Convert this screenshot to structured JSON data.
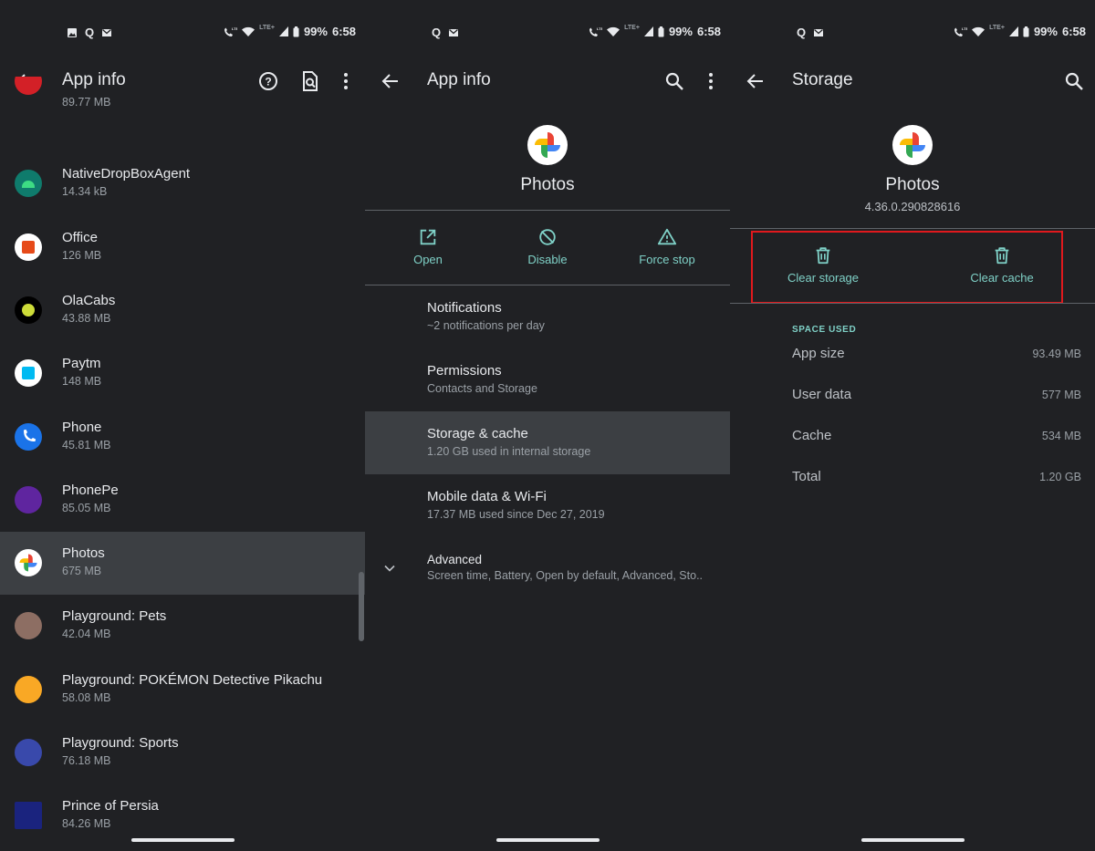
{
  "status": {
    "battery": "99%",
    "time": "6:58",
    "lte": "LTE+"
  },
  "panel1": {
    "title": "App info",
    "apps": [
      {
        "name": "",
        "size": "89.77 MB",
        "icon": "jio-icon",
        "color": "#d32027"
      },
      {
        "name": "NativeDropBoxAgent",
        "size": "14.34 kB",
        "icon": "android-icon",
        "color": "#3ddc84"
      },
      {
        "name": "Office",
        "size": "126 MB",
        "icon": "office-icon",
        "color": "#e64a19"
      },
      {
        "name": "OlaCabs",
        "size": "43.88 MB",
        "icon": "ola-icon",
        "color": "#cddc39"
      },
      {
        "name": "Paytm",
        "size": "148 MB",
        "icon": "paytm-icon",
        "color": "#00baf2"
      },
      {
        "name": "Phone",
        "size": "45.81 MB",
        "icon": "phone-icon",
        "color": "#1a73e8"
      },
      {
        "name": "PhonePe",
        "size": "85.05 MB",
        "icon": "phonepe-icon",
        "color": "#5f259f"
      },
      {
        "name": "Photos",
        "size": "675 MB",
        "icon": "photos-icon",
        "color": "#ffffff"
      },
      {
        "name": "Playground: Pets",
        "size": "42.04 MB",
        "icon": "playground-pets-icon",
        "color": "#8d6e63"
      },
      {
        "name": "Playground: POKÉMON Detective Pikachu",
        "size": "58.08 MB",
        "icon": "pikachu-icon",
        "color": "#f9a825"
      },
      {
        "name": "Playground: Sports",
        "size": "76.18 MB",
        "icon": "playground-sports-icon",
        "color": "#3949ab"
      },
      {
        "name": "Prince of Persia",
        "size": "84.26 MB",
        "icon": "prince-of-persia-icon",
        "color": "#1a237e"
      }
    ]
  },
  "panel2": {
    "title": "App info",
    "app_name": "Photos",
    "actions": [
      {
        "label": "Open",
        "icon": "open-external-icon"
      },
      {
        "label": "Disable",
        "icon": "disable-icon"
      },
      {
        "label": "Force stop",
        "icon": "warning-icon"
      }
    ],
    "menu": [
      {
        "title": "Notifications",
        "sub": "~2 notifications per day"
      },
      {
        "title": "Permissions",
        "sub": "Contacts and Storage"
      },
      {
        "title": "Storage & cache",
        "sub": "1.20 GB used in internal storage"
      },
      {
        "title": "Mobile data & Wi-Fi",
        "sub": "17.37 MB used since Dec 27, 2019"
      }
    ],
    "advanced": {
      "title": "Advanced",
      "sub": "Screen time, Battery, Open by default, Advanced, Sto.."
    }
  },
  "panel3": {
    "title": "Storage",
    "app_name": "Photos",
    "version": "4.36.0.290828616",
    "actions": [
      {
        "label": "Clear storage",
        "icon": "trash-icon"
      },
      {
        "label": "Clear cache",
        "icon": "trash-icon"
      }
    ],
    "section": "SPACE USED",
    "rows": [
      {
        "key": "App size",
        "value": "93.49 MB"
      },
      {
        "key": "User data",
        "value": "577 MB"
      },
      {
        "key": "Cache",
        "value": "534 MB"
      },
      {
        "key": "Total",
        "value": "1.20 GB"
      }
    ]
  },
  "colors": {
    "accent": "#7fd1c7",
    "highlight": "#e0191d",
    "background": "#202124",
    "selected_row": "#3c3f43"
  }
}
